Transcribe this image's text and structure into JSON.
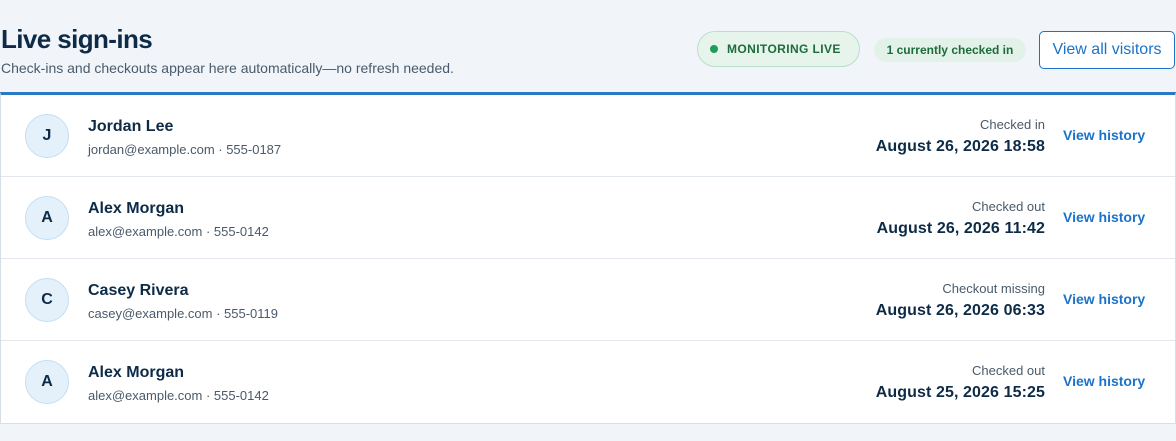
{
  "header": {
    "title": "Live sign-ins",
    "subtitle": "Check-ins and checkouts appear here automatically—no refresh needed.",
    "live_badge": "MONITORING LIVE",
    "count_badge": "1 currently checked in",
    "view_all_label": "View all visitors"
  },
  "colors": {
    "accent": "#1a73c9",
    "live_green": "#1f9d55",
    "title": "#0d2b47"
  },
  "rows": [
    {
      "initial": "J",
      "name": "Jordan Lee",
      "contact": "jordan@example.com · 555-0187",
      "status": "Checked in",
      "datetime": "August 26, 2026 18:58",
      "action": "View history"
    },
    {
      "initial": "A",
      "name": "Alex Morgan",
      "contact": "alex@example.com · 555-0142",
      "status": "Checked out",
      "datetime": "August 26, 2026 11:42",
      "action": "View history"
    },
    {
      "initial": "C",
      "name": "Casey Rivera",
      "contact": "casey@example.com · 555-0119",
      "status": "Checkout missing",
      "datetime": "August 26, 2026 06:33",
      "action": "View history"
    },
    {
      "initial": "A",
      "name": "Alex Morgan",
      "contact": "alex@example.com · 555-0142",
      "status": "Checked out",
      "datetime": "August 25, 2026 15:25",
      "action": "View history"
    }
  ]
}
